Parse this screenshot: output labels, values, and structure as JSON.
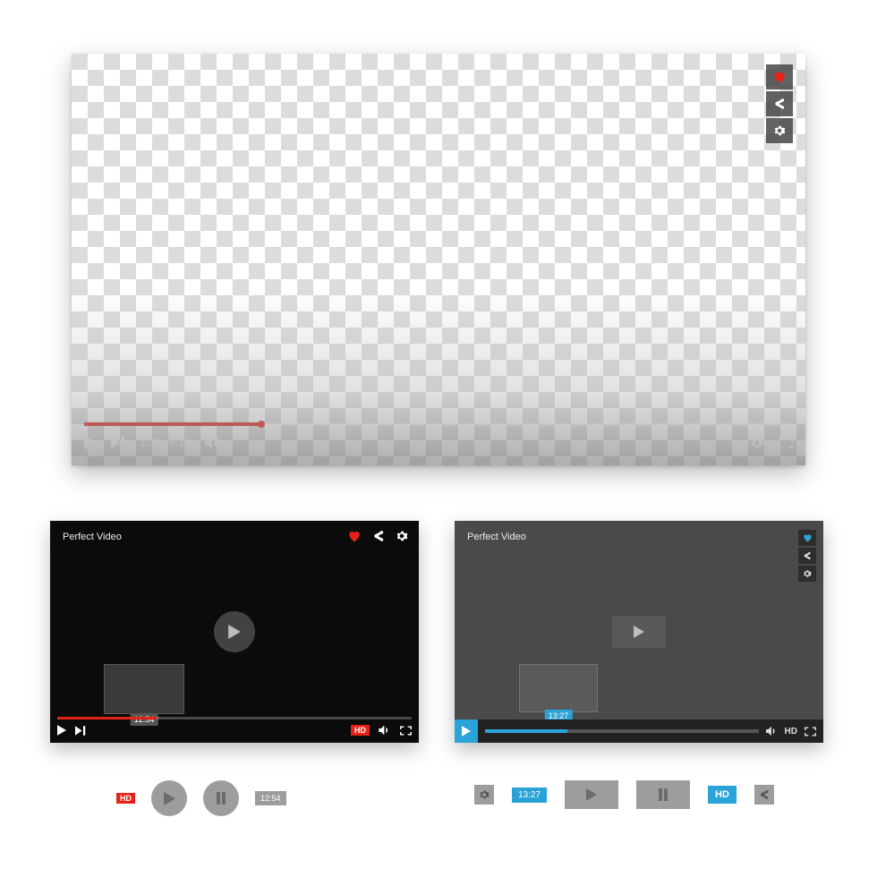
{
  "player1": {
    "current_time": "1:35",
    "total_time": "8:12",
    "time_display": "1:35 / 8:12",
    "progress_pct": 25,
    "side_icons": {
      "like": "heart-icon",
      "share": "share-icon",
      "settings": "gear-icon"
    },
    "controls": {
      "play": "play-icon",
      "next": "next-icon",
      "volume": "volume-icon",
      "settings": "gear-icon",
      "fullscreen": "fullscreen-icon"
    },
    "accent_color": "#e62117"
  },
  "player2": {
    "title": "Perfect Video",
    "thumb_time": "12:54",
    "progress_pct": 28,
    "hd_label": "HD",
    "top_icons": {
      "like": "heart-icon",
      "share": "share-icon",
      "settings": "gear-icon"
    },
    "accent_color": "#e62117"
  },
  "player3": {
    "title": "Perfect Video",
    "thumb_time": "13:27",
    "progress_pct": 30,
    "hd_label": "HD",
    "side_icons": {
      "like": "heart-icon",
      "share": "share-icon",
      "settings": "gear-icon"
    },
    "accent_color": "#29a3d8"
  },
  "controls_row_left": {
    "hd_label": "HD",
    "time_label": "12:54"
  },
  "controls_row_right": {
    "time_label": "13:27",
    "hd_label": "HD"
  },
  "colors": {
    "red": "#e62117",
    "blue": "#29a3d8",
    "grey": "#9d9d9d"
  }
}
